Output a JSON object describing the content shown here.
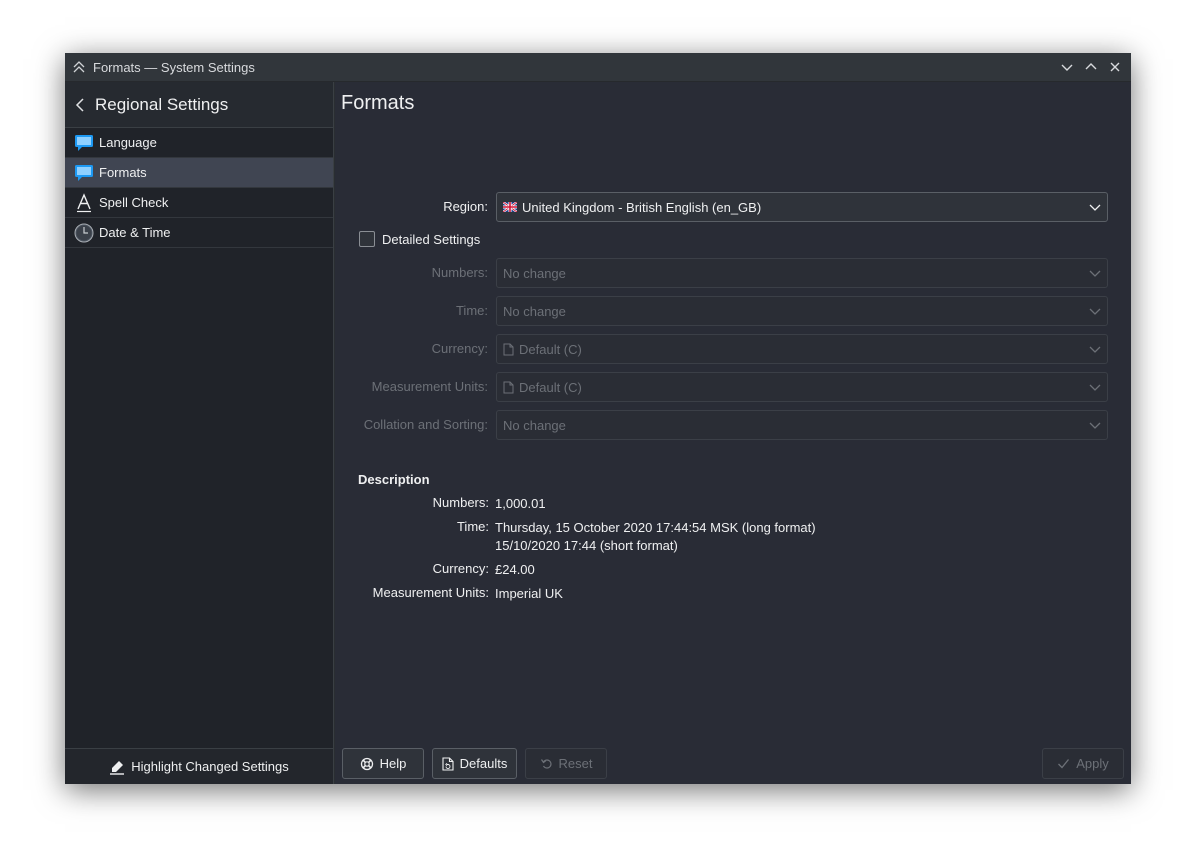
{
  "window": {
    "title": "Formats — System Settings"
  },
  "sidebar": {
    "header": "Regional Settings",
    "items": [
      {
        "label": "Language",
        "icon": "language-icon",
        "active": false
      },
      {
        "label": "Formats",
        "icon": "formats-icon",
        "active": true
      },
      {
        "label": "Spell Check",
        "icon": "spell-check-icon",
        "active": false
      },
      {
        "label": "Date & Time",
        "icon": "clock-icon",
        "active": false
      }
    ],
    "footer": "Highlight Changed Settings"
  },
  "main": {
    "title": "Formats",
    "region": {
      "label": "Region:",
      "value": "United Kingdom - British English (en_GB)"
    },
    "detailed_settings": {
      "label": "Detailed Settings",
      "checked": false
    },
    "fields": [
      {
        "label": "Numbers:",
        "value": "No change",
        "has_doc_icon": false
      },
      {
        "label": "Time:",
        "value": "No change",
        "has_doc_icon": false
      },
      {
        "label": "Currency:",
        "value": "Default (C)",
        "has_doc_icon": true
      },
      {
        "label": "Measurement Units:",
        "value": "Default (C)",
        "has_doc_icon": true
      },
      {
        "label": "Collation and Sorting:",
        "value": "No change",
        "has_doc_icon": false
      }
    ],
    "description": {
      "title": "Description",
      "numbers_label": "Numbers:",
      "numbers_value": "1,000.01",
      "time_label": "Time:",
      "time_long": "Thursday, 15 October 2020 17:44:54 MSK (long format)",
      "time_short": "15/10/2020 17:44 (short format)",
      "currency_label": "Currency:",
      "currency_value": "£24.00",
      "units_label": "Measurement Units:",
      "units_value": "Imperial UK"
    }
  },
  "buttons": {
    "help": "Help",
    "defaults": "Defaults",
    "reset": "Reset",
    "apply": "Apply"
  },
  "colors": {
    "background": "#292c36",
    "sidebar": "#202329",
    "active_item": "#404552",
    "accent": "#3daee9"
  }
}
